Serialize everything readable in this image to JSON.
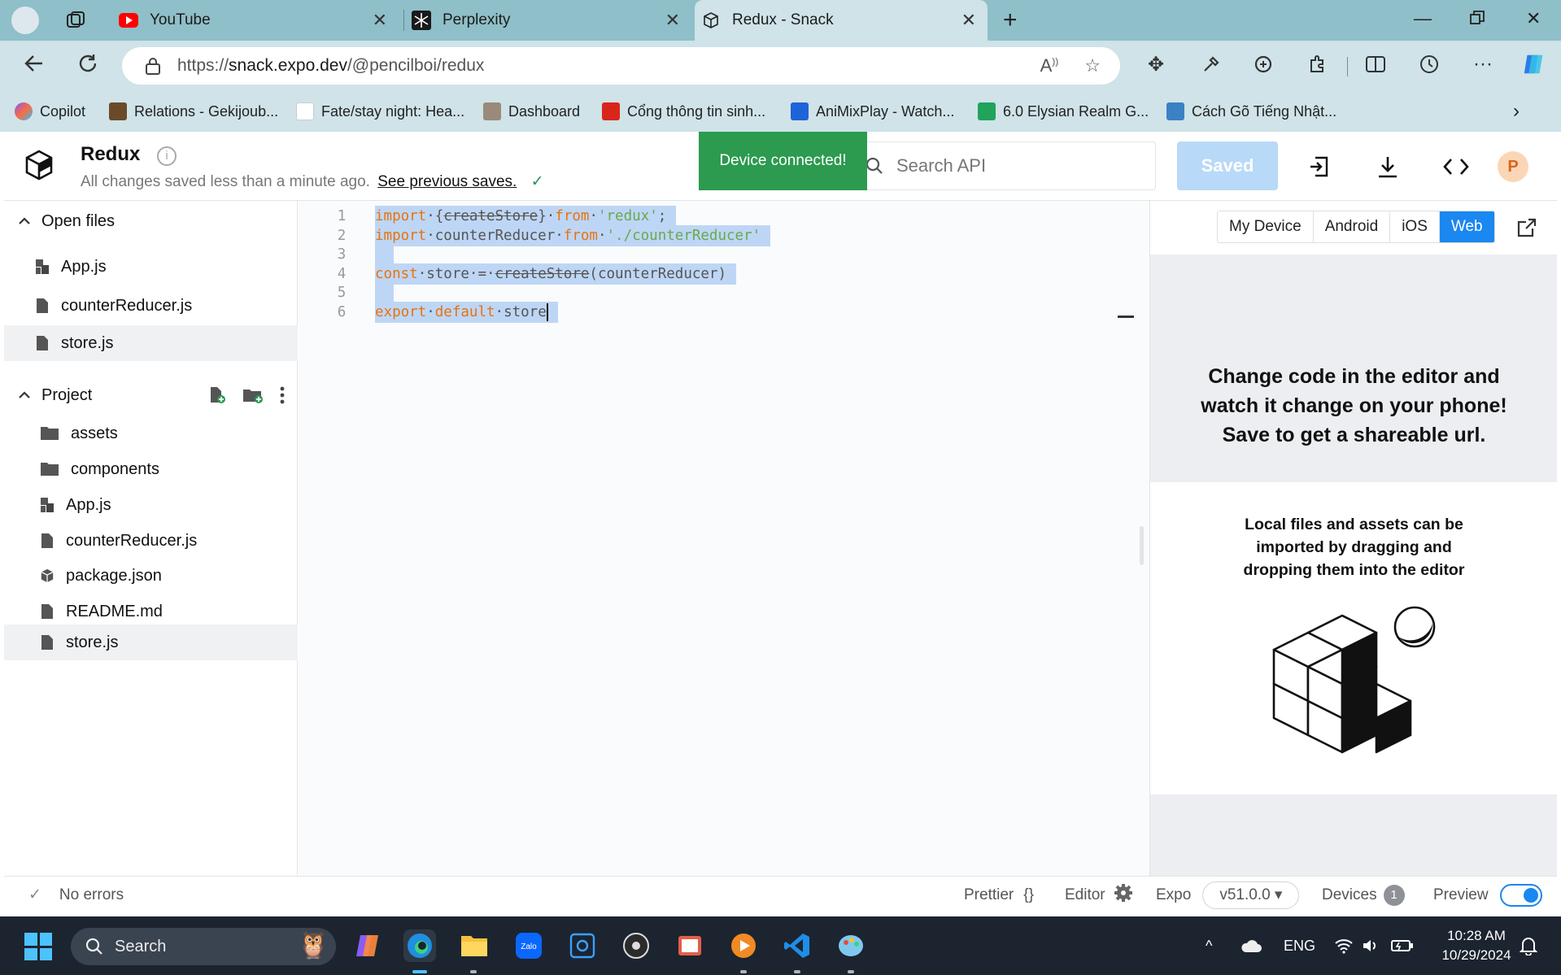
{
  "browser": {
    "tabs": [
      {
        "label": "YouTube",
        "icon": "youtube-icon"
      },
      {
        "label": "Perplexity",
        "icon": "perplexity-icon"
      },
      {
        "label": "Redux - Snack",
        "icon": "snack-icon"
      }
    ],
    "url_prefix": "https://",
    "url_domain": "snack.expo.dev",
    "url_path": "/@pencilboi/redux",
    "bookmarks": [
      {
        "label": "Copilot",
        "color": "#7b5cff"
      },
      {
        "label": "Relations - Gekijoub...",
        "color": "#6b4a2a"
      },
      {
        "label": "Fate/stay night: Hea...",
        "color": "#ffffff"
      },
      {
        "label": "Dashboard",
        "color": "#9a8a7a"
      },
      {
        "label": "Cổng thông tin sinh...",
        "color": "#d8261c"
      },
      {
        "label": "AniMixPlay - Watch...",
        "color": "#1e63d8"
      },
      {
        "label": "6.0 Elysian Realm G...",
        "color": "#21a35b"
      },
      {
        "label": "Cách Gõ Tiếng Nhật...",
        "color": "#3b82c4"
      }
    ]
  },
  "header": {
    "title": "Redux",
    "subtitle": "All changes saved less than a minute ago.",
    "prev_saves": "See previous saves.",
    "toast": "Device connected!",
    "search_placeholder": "Search API",
    "saved_label": "Saved",
    "avatar_letter": "P"
  },
  "sidebar": {
    "open_files_label": "Open files",
    "open_files": [
      "App.js",
      "counterReducer.js",
      "store.js"
    ],
    "project_label": "Project",
    "project_items": [
      {
        "label": "assets",
        "kind": "folder"
      },
      {
        "label": "components",
        "kind": "folder"
      },
      {
        "label": "App.js",
        "kind": "js"
      },
      {
        "label": "counterReducer.js",
        "kind": "file"
      },
      {
        "label": "package.json",
        "kind": "package"
      },
      {
        "label": "README.md",
        "kind": "file"
      },
      {
        "label": "store.js",
        "kind": "file"
      }
    ]
  },
  "editor": {
    "line_numbers": [
      "1",
      "2",
      "3",
      "4",
      "5",
      "6"
    ],
    "lines": [
      [
        {
          "t": "import",
          "c": "kw"
        },
        {
          "t": "·{",
          "c": "plain"
        },
        {
          "t": "createStore",
          "c": "strike"
        },
        {
          "t": "}·",
          "c": "plain"
        },
        {
          "t": "from",
          "c": "kw"
        },
        {
          "t": "·",
          "c": "plain"
        },
        {
          "t": "'redux'",
          "c": "str"
        },
        {
          "t": ";",
          "c": "plain"
        }
      ],
      [
        {
          "t": "import",
          "c": "kw"
        },
        {
          "t": "·counterReducer·",
          "c": "plain"
        },
        {
          "t": "from",
          "c": "kw"
        },
        {
          "t": "·",
          "c": "plain"
        },
        {
          "t": "'./counterReducer'",
          "c": "str"
        }
      ],
      [
        {
          "t": " ",
          "c": "plain"
        }
      ],
      [
        {
          "t": "const",
          "c": "kw"
        },
        {
          "t": "·store·=·",
          "c": "plain"
        },
        {
          "t": "createStore",
          "c": "strike"
        },
        {
          "t": "(counterReducer)",
          "c": "plain"
        }
      ],
      [
        {
          "t": " ",
          "c": "plain"
        }
      ],
      [
        {
          "t": "export",
          "c": "kw"
        },
        {
          "t": "·",
          "c": "plain"
        },
        {
          "t": "default",
          "c": "kw"
        },
        {
          "t": "·store",
          "c": "plain"
        }
      ]
    ]
  },
  "preview": {
    "device_tabs": [
      "My Device",
      "Android",
      "iOS",
      "Web"
    ],
    "active_tab": "Web",
    "message_lines": [
      "Change code in the editor and",
      "watch it change on your phone!",
      "Save to get a shareable url."
    ],
    "drop_lines": [
      "Local files and assets can be",
      "imported by dragging and",
      "dropping them into the editor"
    ]
  },
  "status": {
    "errors": "No errors",
    "prettier": "Prettier",
    "prettier_icon": "{}",
    "editor": "Editor",
    "expo": "Expo",
    "version": "v51.0.0 ▾",
    "devices": "Devices",
    "devices_count": "1",
    "preview": "Preview"
  },
  "taskbar": {
    "search_placeholder": "Search",
    "language": "ENG",
    "time": "10:28 AM",
    "date": "10/29/2024"
  }
}
